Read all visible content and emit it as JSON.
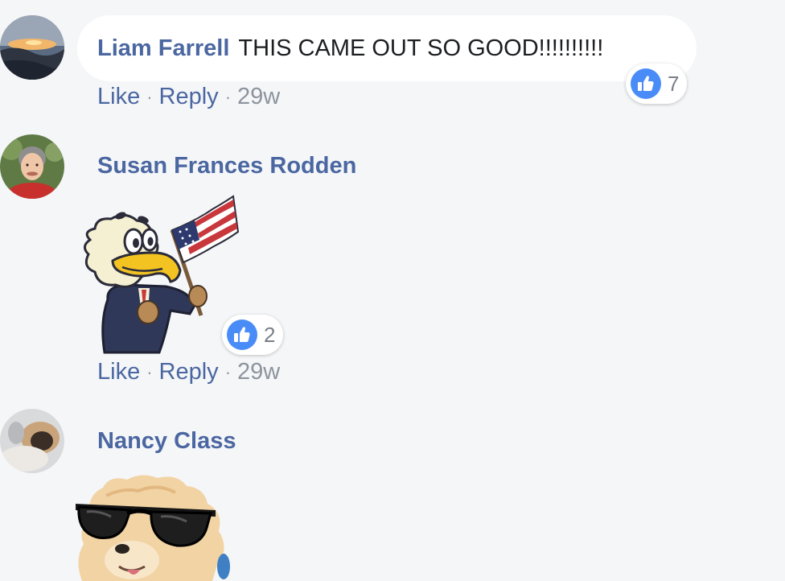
{
  "comments": [
    {
      "author": "Liam Farrell",
      "text": "THIS CAME OUT SO GOOD!!!!!!!!!!",
      "reaction_count": "7",
      "like_label": "Like",
      "reply_label": "Reply",
      "time": "29w",
      "separator": "·"
    },
    {
      "author": "Susan Frances Rodden",
      "sticker": "eagle-with-american-flag-sticker",
      "reaction_count": "2",
      "like_label": "Like",
      "reply_label": "Reply",
      "time": "29w",
      "separator": "·"
    },
    {
      "author": "Nancy Class",
      "sticker": "dog-with-sunglasses-sticker"
    }
  ],
  "colors": {
    "background": "#f5f6f8",
    "name_link": "#4b67a1",
    "meta_gray": "#8d949e",
    "like_blue": "#4a8cf7"
  },
  "icons": [
    "like-thumbs-up-icon"
  ]
}
